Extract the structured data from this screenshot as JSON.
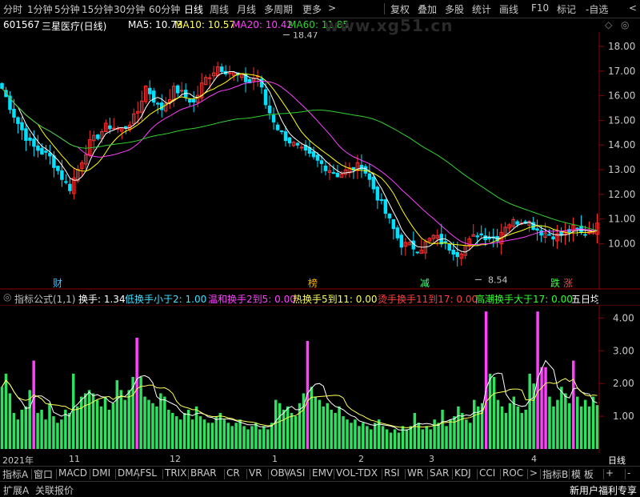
{
  "toolbar": {
    "periods": [
      "分时",
      "1分钟",
      "5分钟",
      "15分钟",
      "30分钟",
      "60分钟",
      "日线",
      "周线",
      "月线",
      "多周期",
      "更多"
    ],
    "more_arrow": ">",
    "actions": [
      "复权",
      "叠加",
      "多股",
      "统计",
      "画线",
      "F10",
      "标记",
      "-自选"
    ],
    "collapse_arrow": "<"
  },
  "stock": {
    "code": "601567",
    "name": "三星医疗",
    "period": "(日线)"
  },
  "ma": {
    "ma5": "MA5: 10.73",
    "ma10": "MA10: 10.57",
    "ma20": "MA20: 10.42",
    "ma60": "MA60: 11.85",
    "colors": {
      "ma5": "#ffffff",
      "ma10": "#ffff00",
      "ma20": "#ff40ff",
      "ma60": "#30d030"
    }
  },
  "watermark": "www.xg51.cn",
  "main_chart": {
    "price_axis": [
      "18.00",
      "17.00",
      "16.00",
      "15.00",
      "14.00",
      "13.00",
      "12.00",
      "11.00",
      "10.00"
    ],
    "high_label": "18.47",
    "low_label": "8.54",
    "event_markers": [
      {
        "label": "财",
        "color": "#40c0ff"
      },
      {
        "label": "榜",
        "color": "#ffb000"
      },
      {
        "label": "减",
        "color": "#40ff80"
      },
      {
        "label": "跌",
        "color": "#40ff40"
      },
      {
        "label": "涨",
        "color": "#ff4040"
      }
    ]
  },
  "indicator": {
    "name": "指标公式(1,1)",
    "value_label": "换手: 1.34",
    "legend": [
      {
        "text": "低换手小于2: 1.00",
        "color": "#40e0ff"
      },
      {
        "text": "温和换手2到5: 0.00",
        "color": "#ff40ff"
      },
      {
        "text": "热换手5到11: 0.00",
        "color": "#ffff55"
      },
      {
        "text": "烫手换手11到17: 0.00",
        "color": "#ff4040"
      },
      {
        "text": "高潮换手大于17: 0.00",
        "color": "#30ff30"
      },
      {
        "text": "五日均",
        "color": "#ffffff"
      }
    ],
    "axis": [
      "4.00",
      "3.00",
      "2.00",
      "1.00"
    ]
  },
  "date_axis": {
    "labels": [
      "2021年",
      "11",
      "12",
      "1",
      "2",
      "3",
      "4"
    ],
    "period_label": "日线"
  },
  "chart_data": {
    "type": "bar",
    "title": "",
    "series": [
      {
        "name": "换手",
        "values": [
          1.9,
          2.3,
          1.7,
          1.1,
          0.9,
          1.2,
          1.3,
          1.8,
          2.7,
          1.1,
          1.2,
          0.9,
          1.4,
          1.0,
          0.8,
          0.9,
          1.2,
          1.1,
          2.3,
          1.3,
          1.6,
          1.7,
          1.8,
          1.7,
          1.5,
          1.3,
          1.6,
          1.2,
          1.4,
          2.1,
          1.8,
          1.5,
          1.8,
          2.2,
          3.4,
          2.2,
          1.6,
          1.5,
          1.4,
          1.3,
          1.7,
          1.6,
          1.2,
          1.1,
          1.0,
          0.9,
          1.1,
          1.2,
          0.9,
          1.3,
          1.0,
          0.9,
          0.8,
          0.8,
          1.0,
          1.1,
          0.9,
          0.8,
          0.7,
          0.8,
          0.9,
          0.7,
          0.6,
          0.7,
          0.8,
          0.6,
          0.7,
          0.6,
          0.8,
          1.5,
          1.4,
          1.2,
          1.3,
          1.1,
          1.0,
          1.4,
          1.7,
          3.3,
          1.9,
          1.6,
          1.5,
          1.3,
          1.4,
          1.2,
          1.1,
          1.3,
          1.0,
          0.9,
          0.8,
          0.9,
          0.7,
          0.8,
          0.7,
          0.6,
          0.8,
          0.9,
          0.7,
          0.6,
          0.5,
          0.6,
          0.5,
          0.7,
          0.6,
          0.7,
          1.1,
          0.8,
          0.6,
          0.7,
          0.6,
          0.9,
          0.8,
          1.2,
          0.7,
          0.9,
          1.0,
          1.3,
          1.1,
          0.9,
          0.8,
          1.5,
          1.3,
          1.4,
          4.2,
          2.3,
          2.2,
          1.5,
          1.3,
          1.1,
          1.4,
          1.6,
          1.3,
          1.1,
          1.2,
          2.3,
          2.0,
          4.2,
          2.5,
          2.5,
          1.6,
          1.3,
          1.5,
          1.9,
          1.7,
          1.4,
          2.7,
          1.6,
          1.3,
          1.5,
          1.3,
          1.6,
          1.34
        ]
      }
    ],
    "ylim": [
      0,
      4.4
    ]
  },
  "tabs": [
    "指标A",
    "窗口",
    "MACD",
    "DMI",
    "DMA",
    "FSL",
    "TRIX",
    "BRAR",
    "CR",
    "VR",
    "OBV",
    "ASI",
    "EMV",
    "VOL-TDX",
    "RSI",
    "WR",
    "SAR",
    "KDJ",
    "CCI",
    "ROC",
    ">",
    "指标B",
    "模 板",
    "+",
    "-"
  ],
  "bottom_bar": {
    "left": [
      "扩展A",
      "关联报价"
    ],
    "notice": "新用户福利专享"
  }
}
